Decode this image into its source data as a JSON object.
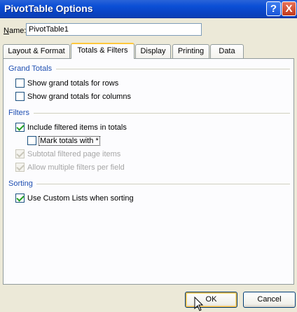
{
  "window": {
    "title": "PivotTable Options",
    "help_glyph": "?",
    "close_glyph": "X"
  },
  "name_field": {
    "label_access": "N",
    "label_rest": "ame:",
    "value": "PivotTable1"
  },
  "tabs": [
    {
      "label": "Layout & Format",
      "active": false
    },
    {
      "label": "Totals & Filters",
      "active": true
    },
    {
      "label": "Display",
      "active": false
    },
    {
      "label": "Printing",
      "active": false
    },
    {
      "label": "Data",
      "active": false
    }
  ],
  "groups": {
    "grand_totals": {
      "title": "Grand Totals",
      "items": [
        {
          "label": "Show grand totals for rows",
          "checked": false,
          "enabled": true
        },
        {
          "label": "Show grand totals for columns",
          "checked": false,
          "enabled": true
        }
      ]
    },
    "filters": {
      "title": "Filters",
      "items": [
        {
          "label": "Include filtered items in totals",
          "checked": true,
          "enabled": true
        },
        {
          "label": "Mark totals with *",
          "checked": false,
          "enabled": true
        },
        {
          "label": "Subtotal filtered page items",
          "checked": true,
          "enabled": false
        },
        {
          "label": "Allow multiple filters per field",
          "checked": true,
          "enabled": false
        }
      ]
    },
    "sorting": {
      "title": "Sorting",
      "items": [
        {
          "label": "Use Custom Lists when sorting",
          "checked": true,
          "enabled": true
        }
      ]
    }
  },
  "buttons": {
    "ok": "OK",
    "cancel": "Cancel"
  },
  "colors": {
    "titlebar": "#0b4fd6",
    "group_title": "#1f4fb2",
    "tab_highlight": "#ffc83c",
    "checkmark": "#21a121"
  }
}
